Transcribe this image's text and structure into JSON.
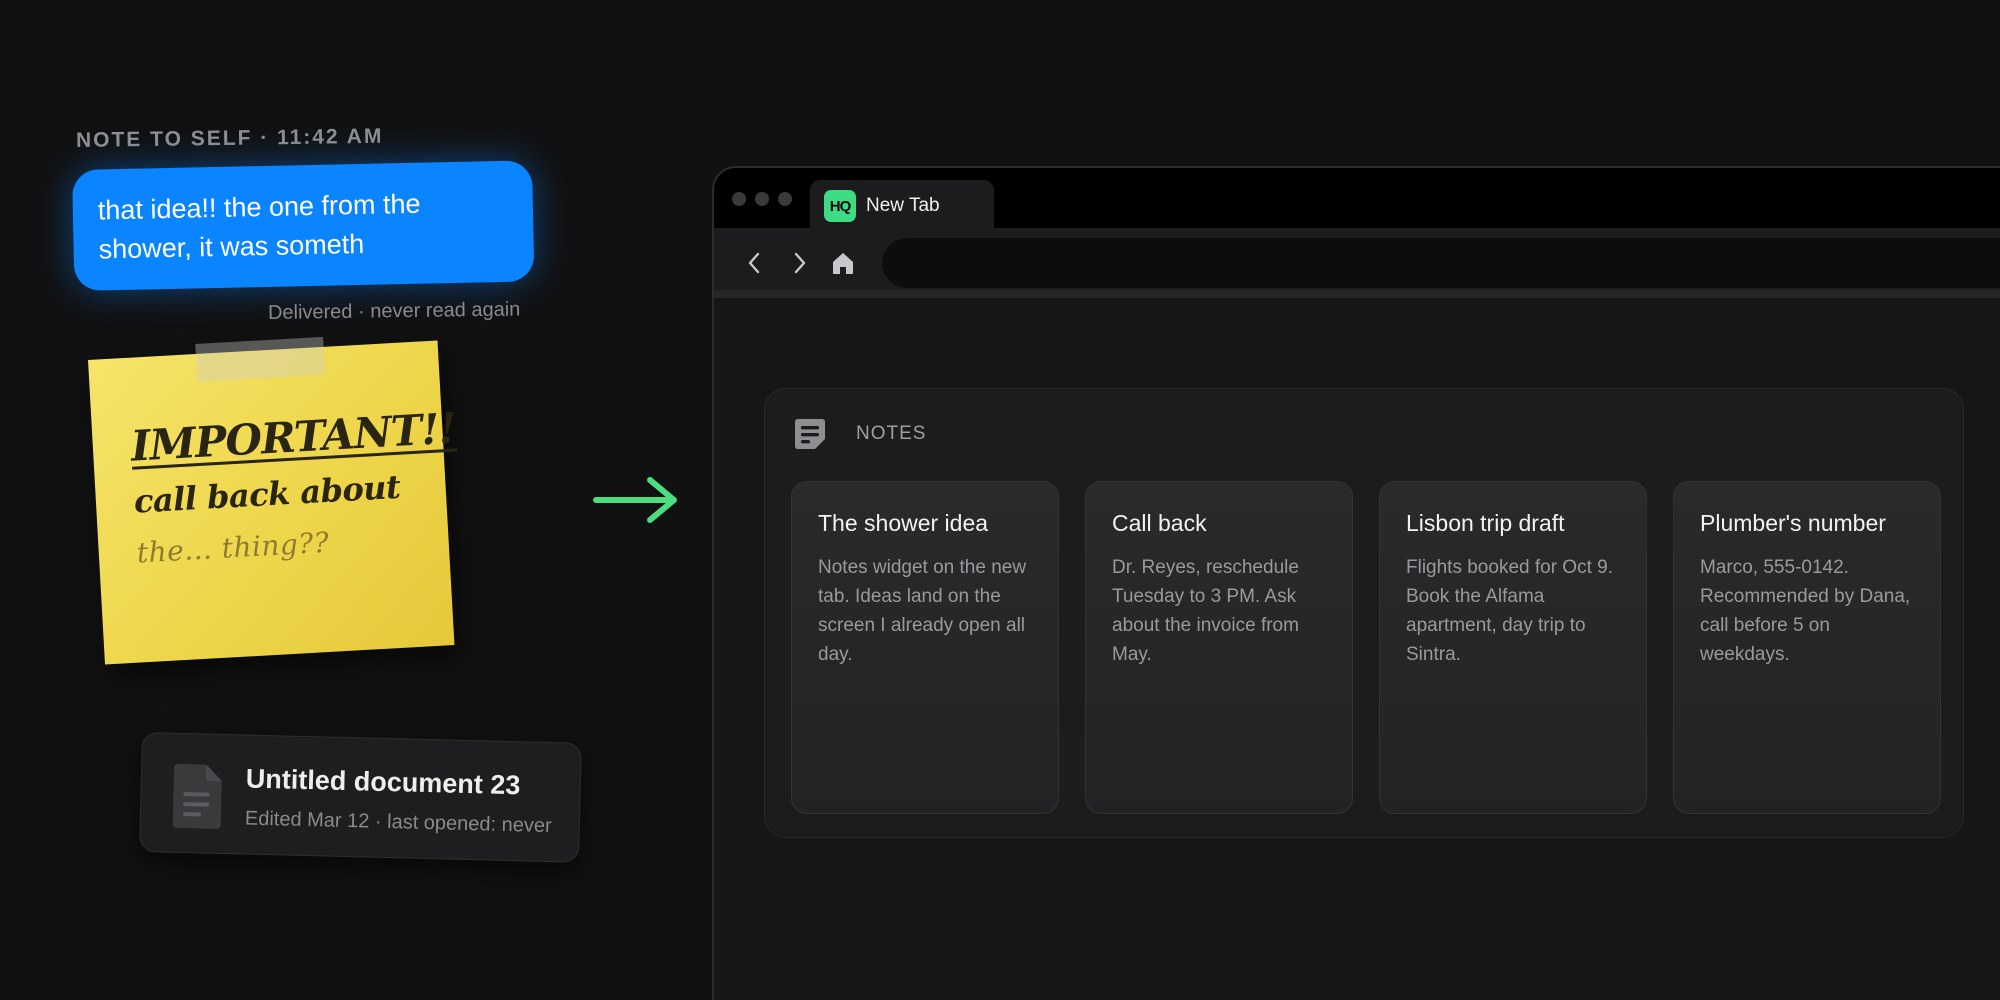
{
  "message": {
    "header": "NOTE TO SELF · 11:42 AM",
    "text": "that idea!! the one from the shower, it was someth",
    "status": "Delivered · never read again"
  },
  "sticky": {
    "title": "IMPORTANT!!",
    "line1": "call back about",
    "line2": "the... thing??"
  },
  "document": {
    "title": "Untitled document 23",
    "subtitle": "Edited Mar 12 · last opened: never",
    "icon": "document-icon"
  },
  "arrow": {
    "icon": "arrow-right-icon",
    "color": "#4ade80"
  },
  "browser": {
    "tab": {
      "favicon_text": "HQ",
      "title": "New Tab",
      "favicon_color": "#3ddc84"
    },
    "toolbar": {
      "back_icon": "chevron-left-icon",
      "forward_icon": "chevron-right-icon",
      "home_icon": "home-icon"
    },
    "address": ""
  },
  "notes_widget": {
    "title": "NOTES",
    "icon": "notes-icon",
    "notes": [
      {
        "title": "The shower idea",
        "body": "Notes widget on the new tab. Ideas land on the screen I already open all day."
      },
      {
        "title": "Call back",
        "body": "Dr. Reyes, reschedule Tuesday to 3 PM. Ask about the invoice from May."
      },
      {
        "title": "Lisbon trip draft",
        "body": "Flights booked for Oct 9. Book the Alfama apartment, day trip to Sintra."
      },
      {
        "title": "Plumber's number",
        "body": "Marco, 555-0142. Recommended by Dana, call before 5 on weekdays."
      }
    ]
  },
  "colors": {
    "background": "#111112",
    "bubble": "#0a84ff",
    "sticky": "#f2dc56",
    "accent_green": "#4ade80"
  }
}
